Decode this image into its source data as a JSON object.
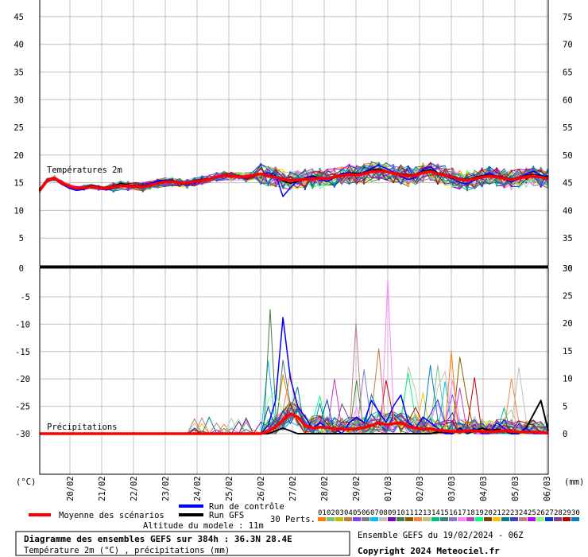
{
  "chart_data": {
    "type": "line",
    "title": "Diagramme des ensembles GEFS sur 384h : 36.3N 28.4E",
    "subtitle": "Température 2m (°C) , précipitations (mm)",
    "altitude": "Altitude du modele : 11m",
    "run_info": "Ensemble GEFS du 19/02/2024 - 06Z",
    "copyright": "Copyright 2024 Meteociel.fr",
    "x_dates": [
      "20/02",
      "21/02",
      "22/02",
      "23/02",
      "24/02",
      "25/02",
      "26/02",
      "27/02",
      "28/02",
      "29/02",
      "01/03",
      "02/03",
      "03/03",
      "04/03",
      "05/03",
      "06/03"
    ],
    "temperature_panel": {
      "label": "Températures 2m",
      "left_ticks": [
        "45",
        "40",
        "35",
        "30",
        "25",
        "20",
        "15",
        "10",
        "5",
        "0"
      ],
      "right_ticks": [
        "75",
        "70",
        "65",
        "60",
        "55",
        "50",
        "45",
        "40",
        "35",
        "30"
      ],
      "ylim": [
        0,
        48
      ],
      "mean": [
        13.6,
        15.4,
        15.8,
        15,
        14.4,
        14,
        14.1,
        14.3,
        14.1,
        14,
        14.2,
        14.5,
        14.4,
        14.3,
        14.2,
        14.5,
        14.9,
        15.1,
        15.2,
        15,
        14.8,
        15.2,
        15.4,
        15.6,
        16,
        16.3,
        16.1,
        16.2,
        16,
        16.4,
        16.6,
        16.2,
        16,
        15.6,
        15.4,
        15.5,
        15.6,
        15.7,
        15.8,
        15.7,
        16,
        16.3,
        16.5,
        16.4,
        16.6,
        17,
        17.1,
        17,
        16.7,
        16.4,
        16.2,
        16.3,
        16.8,
        17,
        16.6,
        16.3,
        16,
        15.6,
        15.4,
        15.7,
        16,
        16.2,
        16,
        15.8,
        15.5,
        15.8,
        16.1,
        16.2,
        16,
        15.8
      ],
      "control": [
        13.6,
        15.2,
        15.6,
        14.8,
        14,
        13.6,
        13.8,
        14.2,
        14,
        13.7,
        14,
        14.5,
        14.3,
        14.2,
        14.4,
        14.8,
        15.3,
        15.5,
        15.2,
        14.8,
        14.5,
        14.9,
        15.3,
        15.7,
        16.2,
        16.5,
        16.2,
        16.1,
        15.8,
        16.2,
        16.6,
        16.8,
        16.5,
        12.5,
        14.1,
        15.3,
        15.8,
        16.1,
        15.6,
        15.2,
        15.9,
        16.7,
        16.8,
        16.4,
        16.9,
        17.6,
        18.2,
        17.6,
        16.9,
        16.1,
        15.6,
        15.9,
        17.4,
        17.9,
        16.8,
        16.2,
        15.7,
        15,
        14.8,
        15.4,
        16.2,
        16.8,
        16.1,
        15.7,
        15.1,
        15.7,
        16.6,
        17.1,
        16.4,
        15.9
      ],
      "gfs": [
        13.6,
        15.5,
        15.9,
        15.1,
        14.5,
        14.1,
        14.2,
        14.6,
        14.3,
        14.1,
        14.4,
        14.9,
        14.6,
        14.5,
        14.4,
        14.7,
        15.1,
        15.3,
        15.4,
        15.1,
        14.9,
        15.4,
        15.6,
        15.8,
        16.1,
        16.4,
        16.2,
        16.3,
        16.1,
        16.5,
        16.7,
        16.4,
        16.2,
        15.3,
        14.9,
        15.2,
        15.9,
        16.2,
        15.9,
        15.6,
        16.1,
        16.6,
        16.8,
        16.7,
        16.8,
        17.3,
        17.5,
        17.1,
        16.8,
        16.6,
        16.4,
        16.5,
        17.1,
        17.3,
        16.8,
        16.5,
        16.2,
        15.8,
        15.6,
        15.9,
        16.3,
        16.5,
        16.2,
        16,
        15.7,
        16,
        16.4,
        16.5,
        16.3,
        16.1
      ]
    },
    "precipitation_panel": {
      "label": "Précipitations",
      "left_ticks": [
        "-5",
        "-10",
        "-15",
        "-20",
        "-25",
        "-30"
      ],
      "right_ticks": [
        "30",
        "25",
        "20",
        "15",
        "10",
        "5",
        "0"
      ],
      "ylim": [
        0,
        30
      ],
      "max_member_peaks": [
        {
          "date": "26/02",
          "value": 22.5
        },
        {
          "date": "01/03",
          "value": 28
        },
        {
          "date": "29/02",
          "value": 20
        },
        {
          "date": "03/03",
          "value": 15
        }
      ],
      "mean": [
        0,
        0,
        0,
        0,
        0,
        0,
        0,
        0,
        0,
        0,
        0,
        0,
        0,
        0,
        0,
        0,
        0,
        0,
        0,
        0,
        0,
        0,
        0,
        0,
        0,
        0,
        0,
        0,
        0,
        0,
        0,
        0.4,
        1.2,
        2.4,
        3.6,
        3,
        1.5,
        1,
        1.2,
        1.1,
        0.9,
        0.8,
        0.8,
        0.9,
        1.1,
        1.5,
        2,
        1.6,
        1.8,
        2,
        1.3,
        1,
        0.8,
        0.9,
        0.6,
        0.5,
        0.4,
        0.4,
        0.5,
        0.5,
        0.4,
        0.3,
        0.4,
        0.5,
        0.4,
        0.3,
        0.3,
        0.3,
        0.2,
        0.1
      ],
      "control": [
        0,
        0,
        0,
        0,
        0,
        0,
        0,
        0,
        0,
        0,
        0,
        0,
        0,
        0,
        0,
        0,
        0,
        0,
        0,
        0,
        0,
        0,
        0,
        0,
        0,
        0,
        0,
        0,
        0,
        0,
        0,
        1.5,
        6,
        21,
        10,
        5,
        3,
        1,
        2,
        1,
        1,
        0,
        2,
        3,
        2,
        6,
        4,
        2,
        5,
        7,
        2,
        1,
        3,
        2,
        1,
        0,
        0,
        1,
        0,
        1,
        0,
        0,
        2,
        1,
        0,
        0,
        1,
        0,
        0,
        0
      ],
      "gfs": [
        0,
        0,
        0,
        0,
        0,
        0,
        0,
        0,
        0,
        0,
        0,
        0,
        0,
        0,
        0,
        0,
        0,
        0,
        0,
        0,
        0,
        0,
        0,
        0,
        0,
        0,
        0,
        0,
        0,
        0,
        0,
        0,
        0.5,
        1,
        0.5,
        0,
        0,
        0,
        0,
        0,
        0,
        0,
        0,
        0,
        0,
        0,
        0,
        0,
        0,
        0,
        0,
        0,
        0,
        0,
        0.3,
        0.2,
        0,
        1,
        0,
        0.5,
        1,
        0.6,
        0.8,
        0.5,
        0,
        0,
        1,
        3.5,
        6,
        0.5
      ]
    },
    "legend": {
      "mean": "Moyenne des scénarios",
      "control": "Run de contrôle",
      "gfs": "Run GFS",
      "perts": "30 Perts.",
      "perts_nums": [
        "01",
        "02",
        "03",
        "04",
        "05",
        "06",
        "07",
        "08",
        "09",
        "10",
        "11",
        "12",
        "13",
        "14",
        "15",
        "16",
        "17",
        "18",
        "19",
        "20",
        "21",
        "22",
        "23",
        "24",
        "25",
        "26",
        "27",
        "28",
        "29",
        "30"
      ],
      "perts_colors": [
        "#ff8000",
        "#80c080",
        "#c0c000",
        "#c08040",
        "#8040ff",
        "#808080",
        "#00c0ff",
        "#c0c0c0",
        "#8000c0",
        "#408040",
        "#806000",
        "#ff8040",
        "#c0c080",
        "#00c080",
        "#408080",
        "#8080c0",
        "#ff80ff",
        "#c040c0",
        "#00ff80",
        "#804000",
        "#ffc000",
        "#008080",
        "#4040c0",
        "#c08080",
        "#c000ff",
        "#80ff80",
        "#0040c0",
        "#804080",
        "#c00000",
        "#0080c0"
      ]
    },
    "units": {
      "left": "(°C)",
      "right": "(mm)"
    },
    "colors": {
      "mean": "#ff0000",
      "control": "#0000ff",
      "gfs": "#000000",
      "grid": "#c0c0c0"
    }
  }
}
